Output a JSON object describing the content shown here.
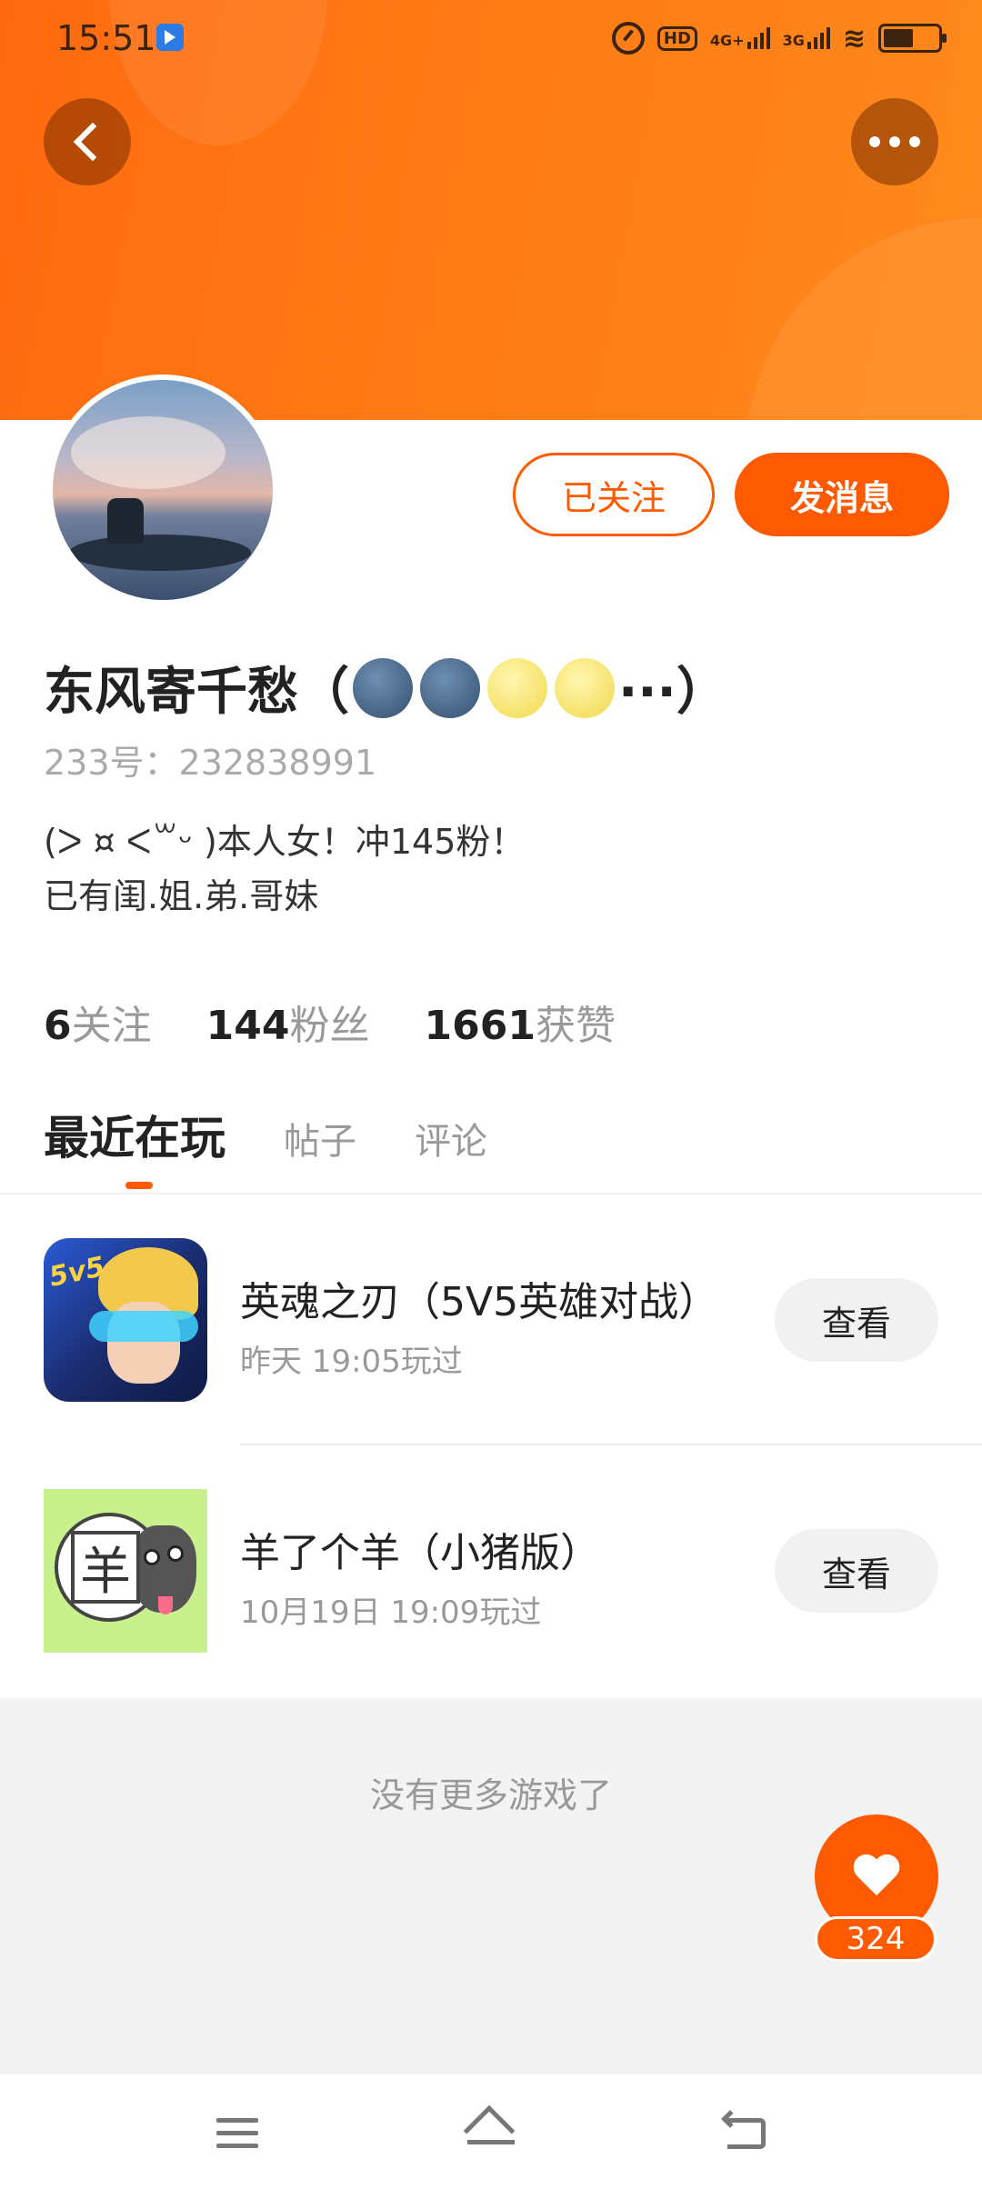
{
  "status_bar": {
    "time": "15:51",
    "hd_label": "HD",
    "network_1": "4G+",
    "network_2": "3G"
  },
  "header": {
    "back_icon": "chevron-left-icon",
    "more_icon": "more-dots-icon",
    "banner_color": "#ff7a14"
  },
  "profile": {
    "follow_button": "已关注",
    "message_button": "发消息",
    "name": "东风寄千愁（",
    "name_suffix": "···）",
    "id_line": "233号：232838991",
    "bio_line1": "(ᐳ ¤ ᐸ꒳ᵕ )本人女！冲145粉！",
    "bio_line2": "已有闺.姐.弟.哥妹"
  },
  "stats": [
    {
      "num": "6",
      "label": "关注"
    },
    {
      "num": "144",
      "label": "粉丝"
    },
    {
      "num": "1661",
      "label": "获赞"
    }
  ],
  "tabs": [
    {
      "label": "最近在玩",
      "active": true
    },
    {
      "label": "帖子",
      "active": false
    },
    {
      "label": "评论",
      "active": false
    }
  ],
  "games": [
    {
      "title": "英魂之刃（5V5英雄对战）",
      "time": "昨天  19:05玩过",
      "button": "查看",
      "icon_badge": "5v5"
    },
    {
      "title": "羊了个羊（小猪版）",
      "time": "10月19日  19:09玩过",
      "button": "查看",
      "icon_char": "羊"
    }
  ],
  "list_footer": "没有更多游戏了",
  "like": {
    "count": "324"
  },
  "accent_color": "#ff5a00"
}
